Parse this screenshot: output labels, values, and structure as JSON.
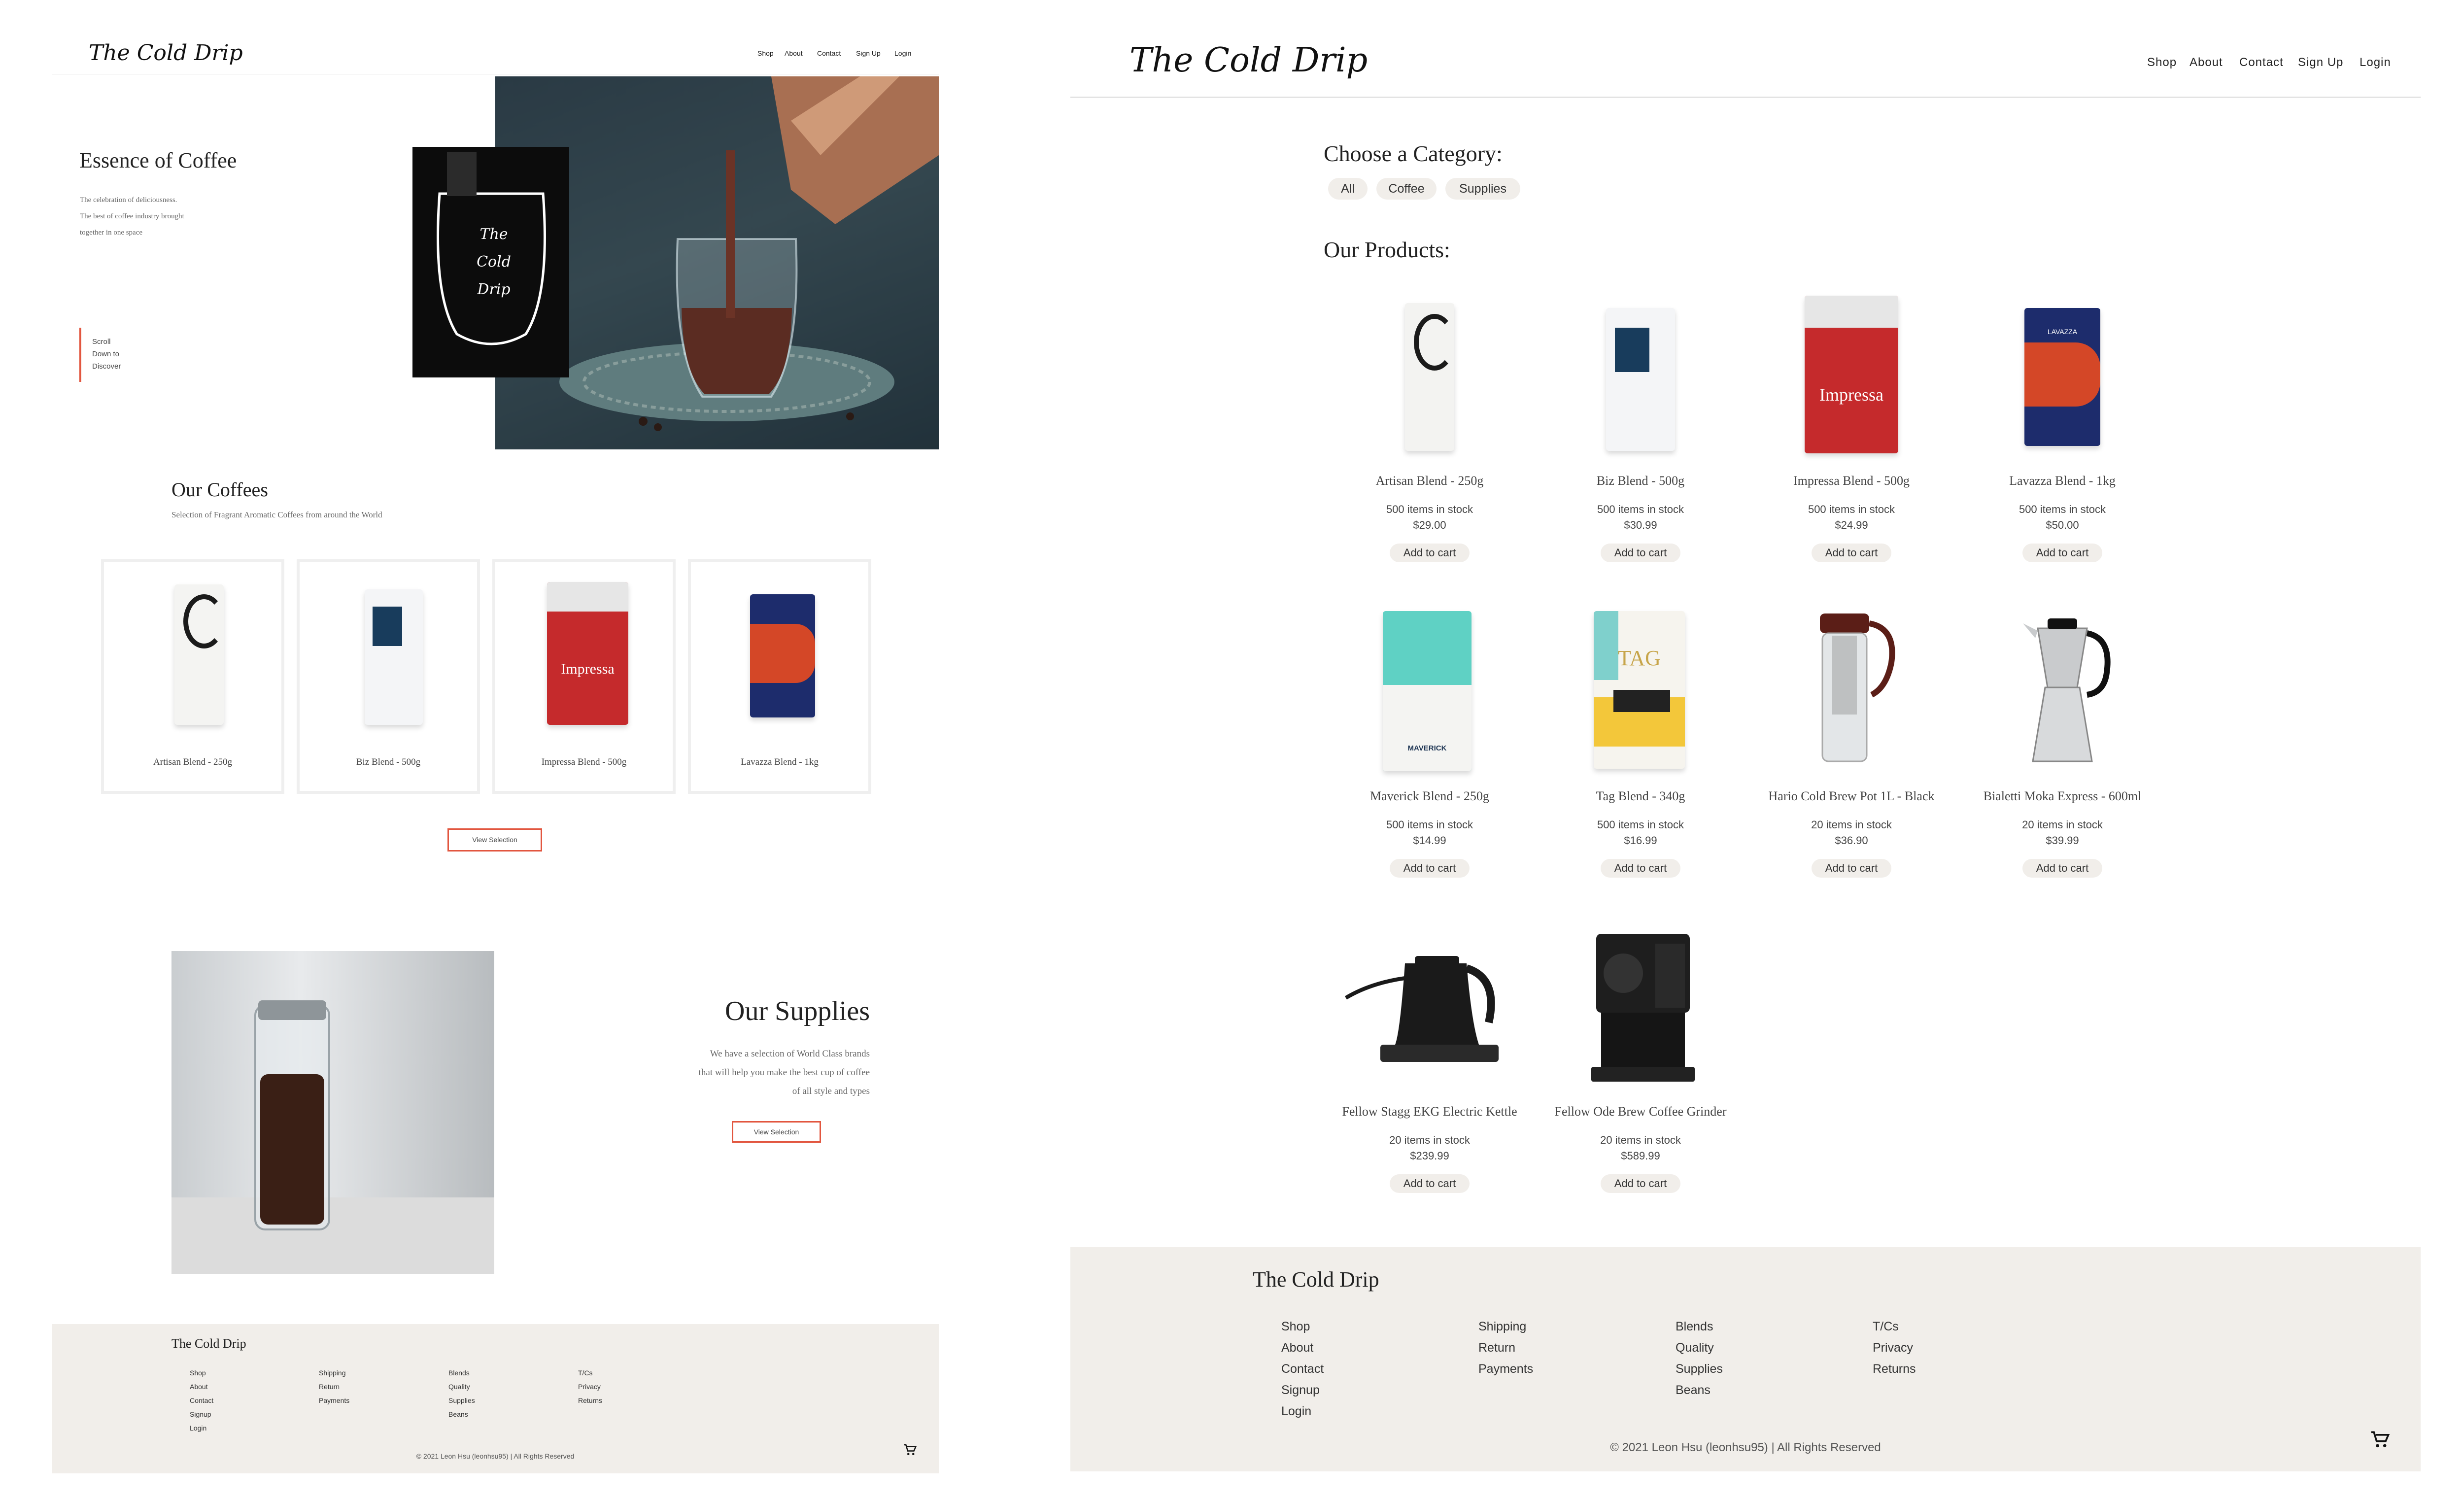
{
  "home": {
    "logo": "The Cold Drip",
    "nav": [
      "Shop",
      "About",
      "Contact",
      "Sign Up",
      "Login"
    ],
    "hero": {
      "title": "Essence of Coffee",
      "text_lines": [
        "The celebration of deliciousness.",
        "The best of coffee industry brought",
        "together in one space"
      ],
      "scroll_lines": [
        "Scroll",
        "Down to",
        "Discover"
      ],
      "glass_text": "The Cold Drip"
    },
    "coffees": {
      "title": "Our Coffees",
      "subtitle": "Selection of Fragrant Aromatic Coffees from around the World",
      "items": [
        "Artisan Blend - 250g",
        "Biz Blend - 500g",
        "Impressa Blend - 500g",
        "Lavazza Blend - 1kg"
      ],
      "button": "View Selection"
    },
    "supplies": {
      "title": "Our Supplies",
      "text_lines": [
        "We have a selection of World Class brands",
        "that will help you make the best cup of coffee",
        "of all style and types"
      ],
      "button": "View Selection"
    },
    "footer": {
      "brand": "The Cold Drip",
      "col1": [
        "Shop",
        "About",
        "Contact",
        "Signup",
        "Login"
      ],
      "col2": [
        "Shipping",
        "Return",
        "Payments"
      ],
      "col3": [
        "Blends",
        "Quality",
        "Supplies",
        "Beans"
      ],
      "col4": [
        "T/Cs",
        "Privacy",
        "Returns"
      ],
      "copyright": "© 2021 Leon Hsu (leonhsu95) | All Rights Reserved"
    }
  },
  "shop": {
    "logo": "The Cold Drip",
    "nav": [
      "Shop",
      "About",
      "Contact",
      "Sign Up",
      "Login"
    ],
    "category_title": "Choose a Category:",
    "categories": [
      "All",
      "Coffee",
      "Supplies"
    ],
    "products_title": "Our Products:",
    "add_to_cart": "Add to cart",
    "products": [
      {
        "name": "Artisan Blend - 250g",
        "stock": "500 items in stock",
        "price": "$29.00"
      },
      {
        "name": "Biz Blend - 500g",
        "stock": "500 items in stock",
        "price": "$30.99"
      },
      {
        "name": "Impressa Blend - 500g",
        "stock": "500 items in stock",
        "price": "$24.99"
      },
      {
        "name": "Lavazza Blend - 1kg",
        "stock": "500 items in stock",
        "price": "$50.00"
      },
      {
        "name": "Maverick Blend - 250g",
        "stock": "500 items in stock",
        "price": "$14.99"
      },
      {
        "name": "Tag Blend - 340g",
        "stock": "500 items in stock",
        "price": "$16.99"
      },
      {
        "name": "Hario Cold Brew Pot 1L - Black",
        "stock": "20 items in stock",
        "price": "$36.90"
      },
      {
        "name": "Bialetti Moka Express - 600ml",
        "stock": "20 items in stock",
        "price": "$39.99"
      },
      {
        "name": "Fellow Stagg EKG Electric Kettle",
        "stock": "20 items in stock",
        "price": "$239.99"
      },
      {
        "name": "Fellow Ode Brew Coffee Grinder",
        "stock": "20 items in stock",
        "price": "$589.99"
      }
    ],
    "bag_labels": {
      "impressa": "Impressa",
      "tag": "TAG",
      "maverick": "MAVERICK",
      "lavazza": "LAVAZZA"
    },
    "footer": {
      "brand": "The Cold Drip",
      "col1": [
        "Shop",
        "About",
        "Contact",
        "Signup",
        "Login"
      ],
      "col2": [
        "Shipping",
        "Return",
        "Payments"
      ],
      "col3": [
        "Blends",
        "Quality",
        "Supplies",
        "Beans"
      ],
      "col4": [
        "T/Cs",
        "Privacy",
        "Returns"
      ],
      "copyright": "© 2021 Leon Hsu (leonhsu95) | All Rights Reserved"
    }
  },
  "icons": {
    "cart": "cart-icon"
  },
  "colors": {
    "accent": "#e2563f",
    "footer_bg": "#f1eeea",
    "pill_bg": "#f1eeea"
  }
}
